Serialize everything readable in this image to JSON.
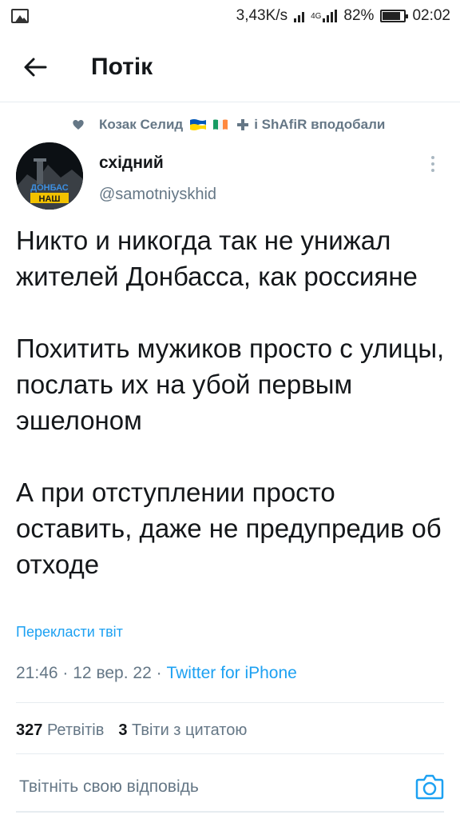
{
  "status_bar": {
    "speed": "3,43K/s",
    "network": "4G",
    "battery": "82%",
    "battery_level": 0.82,
    "time": "02:02"
  },
  "header": {
    "title": "Потік",
    "back_icon": "arrow-left-icon"
  },
  "social_context": {
    "icon": "heart-icon",
    "text_before_flags": "Козак Селид",
    "text_after_flags": "і ShAfiR вподобали",
    "flag_colors": {
      "ukraine_top": "#0057b7",
      "ukraine_bottom": "#ffd700",
      "ireland": [
        "#169b62",
        "#ffffff",
        "#ff883e"
      ]
    }
  },
  "tweet": {
    "author_name": "східний",
    "author_handle": "@samotniyskhid",
    "avatar_text_top": "ДОНБАС",
    "avatar_text_bottom": "НАШ",
    "paragraphs": [
      "Никто и никогда так не унижал жителей Донбасса, как россияне",
      "Похитить мужиков просто с улицы, послать их на убой первым эшелоном",
      "А при отступлении просто оставить, даже не предупредив об отходе"
    ],
    "translate_label": "Перекласти твіт",
    "time": "21:46",
    "date": "12 вер. 22",
    "separator": "·",
    "source": "Twitter for iPhone",
    "retweets_count": "327",
    "retweets_label": "Ретвітів",
    "quotes_count": "3",
    "quotes_label": "Твіти з цитатою"
  },
  "reply": {
    "placeholder": "Твітніть свою відповідь",
    "camera_icon": "camera-icon"
  },
  "colors": {
    "accent": "#1da1f2",
    "secondary_text": "#657786",
    "primary_text": "#14171a",
    "divider": "#e6ecf0"
  }
}
